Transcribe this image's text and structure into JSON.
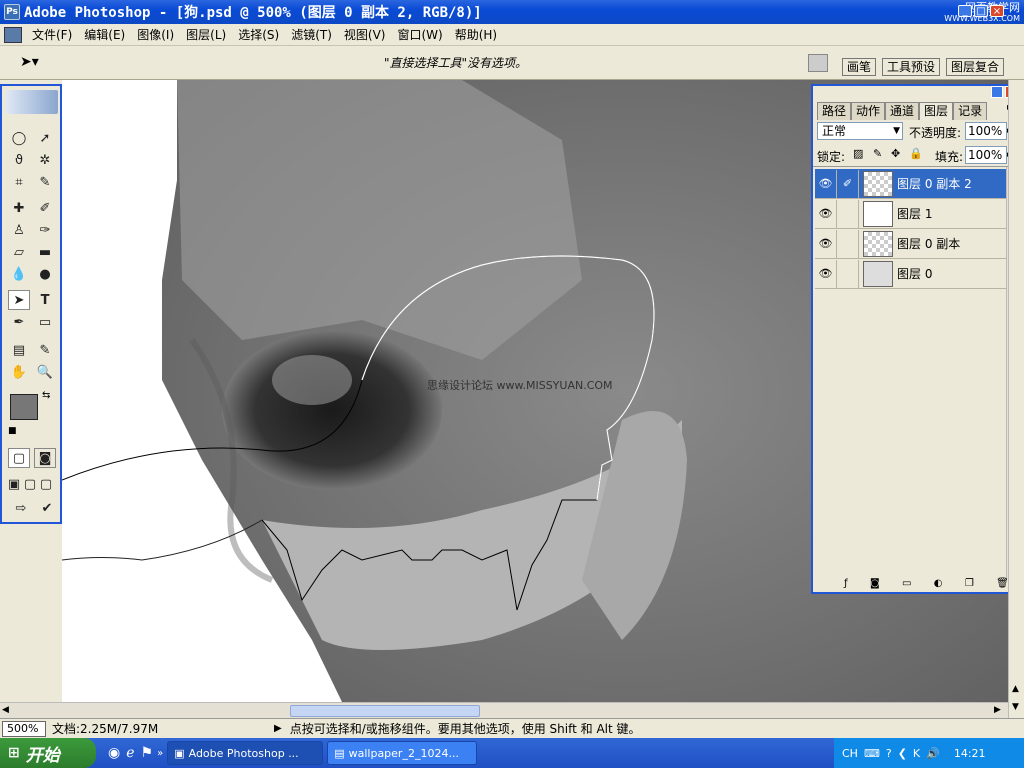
{
  "app": {
    "title": "Adobe Photoshop - [狗.psd @ 500% (图层 0 副本 2, RGB/8)]",
    "watermark_top": "网页教学网",
    "watermark_top_url": "WWW.WEB3X.COM"
  },
  "menu": {
    "items": [
      "文件(F)",
      "编辑(E)",
      "图像(I)",
      "图层(L)",
      "选择(S)",
      "滤镜(T)",
      "视图(V)",
      "窗口(W)",
      "帮助(H)"
    ]
  },
  "options": {
    "hint": "\"直接选择工具\"没有选项。",
    "palette_tabs": [
      "画笔",
      "工具预设",
      "图层复合"
    ]
  },
  "canvas": {
    "watermark": "思缘设计论坛 www.MISSYUAN.COM"
  },
  "layers_panel": {
    "tabs": [
      "路径",
      "动作",
      "通道",
      "图层",
      "记录"
    ],
    "active_tab": "图层",
    "blend_mode": "正常",
    "opacity_label": "不透明度:",
    "opacity_value": "100%",
    "lock_label": "锁定:",
    "fill_label": "填充:",
    "fill_value": "100%",
    "layers": [
      {
        "name": "图层 0 副本 2",
        "selected": true
      },
      {
        "name": "图层 1",
        "selected": false
      },
      {
        "name": "图层 0 副本",
        "selected": false
      },
      {
        "name": "图层 0",
        "selected": false
      }
    ]
  },
  "status": {
    "zoom": "500%",
    "doc": "文档:2.25M/7.97M",
    "message": "点按可选择和/或拖移组件。要用其他选项，使用 Shift 和 Alt 键。"
  },
  "taskbar": {
    "start": "开始",
    "tasks": [
      {
        "label": "Adobe Photoshop ...",
        "active": true
      },
      {
        "label": "wallpaper_2_1024...",
        "active": false
      }
    ],
    "lang": "CH",
    "time": "14:21"
  }
}
